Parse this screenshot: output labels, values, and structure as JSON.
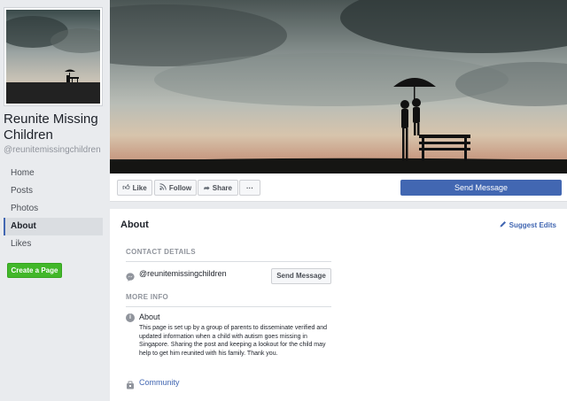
{
  "page": {
    "name": "Reunite Missing Children",
    "handle": "@reunitemissingchildren"
  },
  "sidebar": {
    "items": [
      {
        "label": "Home",
        "active": false
      },
      {
        "label": "Posts",
        "active": false
      },
      {
        "label": "Photos",
        "active": false
      },
      {
        "label": "About",
        "active": true
      },
      {
        "label": "Likes",
        "active": false
      }
    ],
    "create_page": "Create a Page"
  },
  "actions": {
    "like": "Like",
    "follow": "Follow",
    "share": "Share",
    "more": "···",
    "send_message": "Send Message"
  },
  "about": {
    "title": "About",
    "suggest_edits": "Suggest Edits",
    "contact_details_heading": "CONTACT DETAILS",
    "messenger_handle": "@reunitemissingchildren",
    "send_message": "Send Message",
    "more_info_heading": "MORE INFO",
    "about_label": "About",
    "about_text": "This page is set up by a group of parents to disseminate verified and updated information when a child with autism goes missing in Singapore. Sharing the post and keeping a lookout for the child may help to get him reunited with his family. Thank you.",
    "category": "Community"
  },
  "colors": {
    "brand_blue": "#4267b2",
    "create_green": "#42b72a",
    "background": "#e9ebee"
  },
  "icons": {
    "like": "thumbs-up-icon",
    "follow": "rss-icon",
    "share": "share-arrow-icon",
    "messenger": "messenger-icon",
    "info": "info-icon",
    "community": "community-icon",
    "edit": "pencil-icon"
  }
}
